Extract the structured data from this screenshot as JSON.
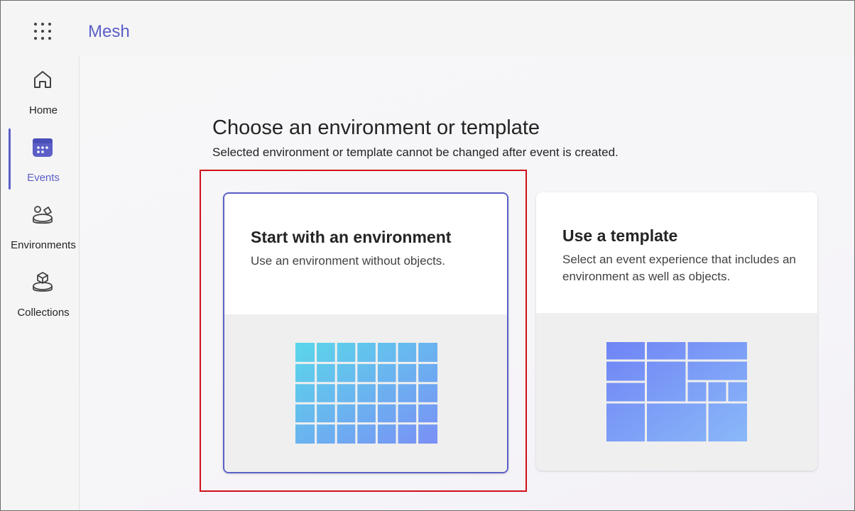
{
  "app": {
    "title": "Mesh"
  },
  "rail": {
    "items": [
      {
        "label": "Home",
        "icon": "home-icon",
        "active": false
      },
      {
        "label": "Events",
        "icon": "calendar-icon",
        "active": true
      },
      {
        "label": "Environments",
        "icon": "environments-icon",
        "active": false
      },
      {
        "label": "Collections",
        "icon": "collections-icon",
        "active": false
      }
    ]
  },
  "main": {
    "heading": "Choose an environment or template",
    "subheading": "Selected environment or template cannot be changed after event is created.",
    "cards": [
      {
        "title": "Start with an environment",
        "description": "Use an environment without objects.",
        "selected": true
      },
      {
        "title": "Use a template",
        "description": "Select an event experience that includes an environment as well as objects.",
        "selected": false
      }
    ]
  },
  "colors": {
    "accent": "#5b5fc7",
    "highlight": "#d0101b"
  }
}
